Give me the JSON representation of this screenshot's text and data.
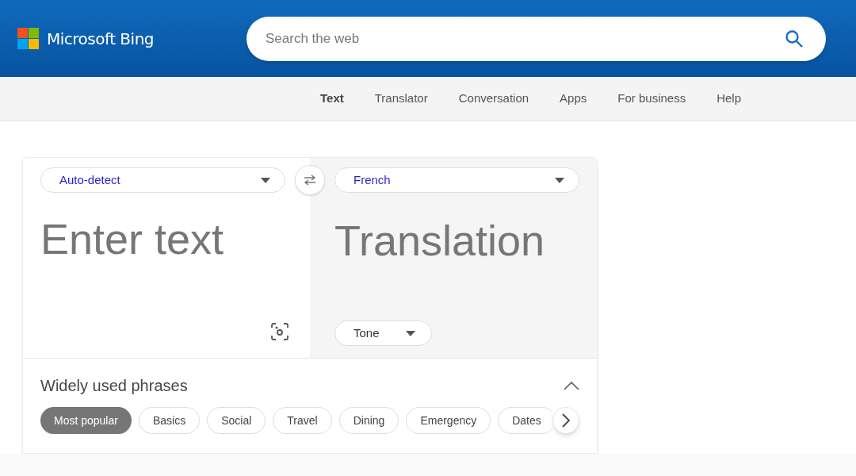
{
  "header": {
    "logo_text": "Microsoft Bing",
    "search": {
      "placeholder": "Search the web"
    }
  },
  "nav": [
    {
      "label": "Text",
      "selected": true
    },
    {
      "label": "Translator",
      "selected": false
    },
    {
      "label": "Conversation",
      "selected": false
    },
    {
      "label": "Apps",
      "selected": false
    },
    {
      "label": "For business",
      "selected": false
    },
    {
      "label": "Help",
      "selected": false
    }
  ],
  "translator": {
    "source_language": "Auto-detect",
    "target_language": "French",
    "input": {
      "placeholder": "Enter text"
    },
    "output_placeholder": "Translation",
    "tone": "Tone"
  },
  "phrases": {
    "title": "Widely used phrases",
    "expanded": true,
    "categories": [
      {
        "label": "Most popular",
        "selected": true
      },
      {
        "label": "Basics",
        "selected": false
      },
      {
        "label": "Social",
        "selected": false
      },
      {
        "label": "Travel",
        "selected": false
      },
      {
        "label": "Dining",
        "selected": false
      },
      {
        "label": "Emergency",
        "selected": false
      },
      {
        "label": "Dates",
        "selected": false
      }
    ]
  }
}
